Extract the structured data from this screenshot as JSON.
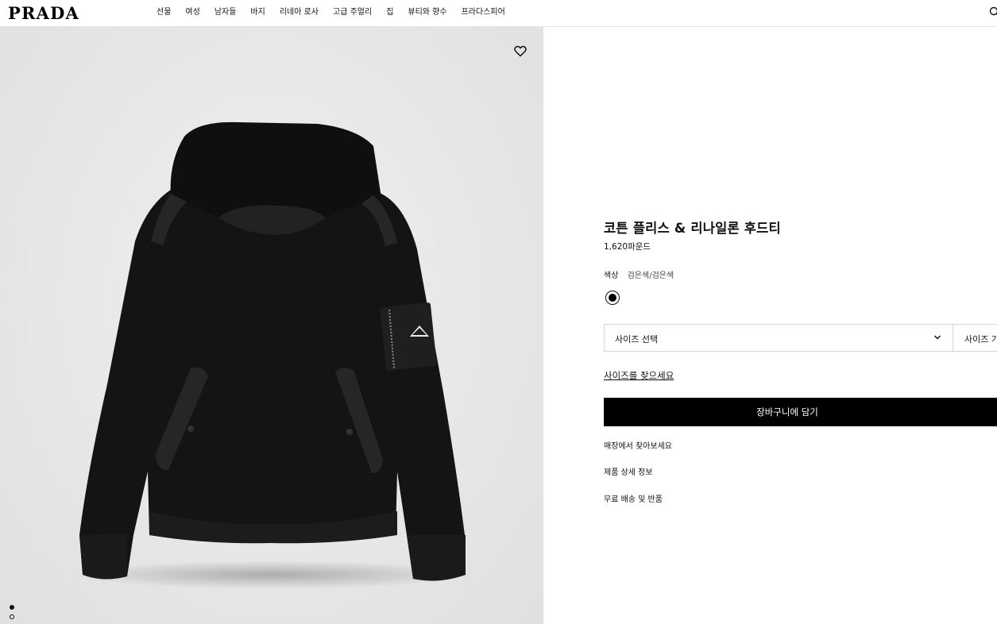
{
  "brand": {
    "logo": "PRADA"
  },
  "nav": {
    "items": [
      {
        "label": "선물"
      },
      {
        "label": "여성"
      },
      {
        "label": "남자들"
      },
      {
        "label": "바지"
      },
      {
        "label": "리네아 로사"
      },
      {
        "label": "고급 주얼리"
      },
      {
        "label": "집"
      },
      {
        "label": "뷰티와 향수"
      },
      {
        "label": "프라다스피어"
      }
    ]
  },
  "gallery": {
    "slides_total": 2,
    "active_slide": 1
  },
  "product": {
    "title": "코튼 플리스 & 리나일론 후드티",
    "price": "1,620파운드",
    "color_label": "색상",
    "color_value": "검은색/검은색",
    "swatch_color": "#000000",
    "size_select_label": "사이즈 선택",
    "size_guide_label": "사이즈 가이드",
    "find_size_link": "사이즈를 찾으세요",
    "add_to_cart": "장바구니에 담기",
    "links": {
      "find_in_store": "매장에서 찾아보세요",
      "product_details": "제품 상세 정보",
      "shipping_returns": "무료 배송 및 반품"
    }
  }
}
